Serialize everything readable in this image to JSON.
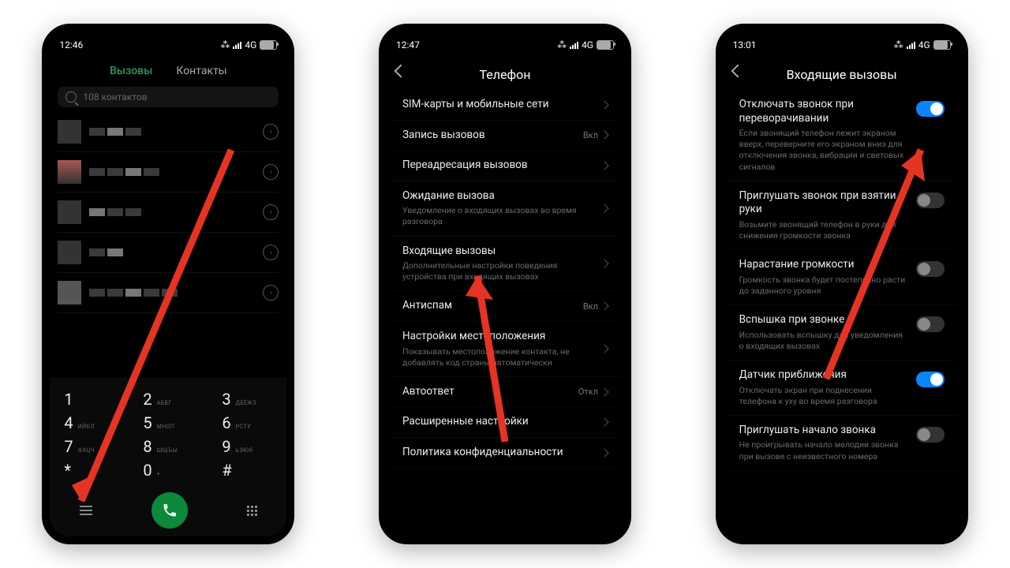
{
  "phone1": {
    "time": "12:46",
    "net": "4G",
    "tabs": {
      "calls": "Вызовы",
      "contacts": "Контакты"
    },
    "search_placeholder": "108 контактов",
    "dial": {
      "k1": "1",
      "k2": "2",
      "k2s": "АБВГ",
      "k3": "3",
      "k3s": "ДЕЁЖЗ",
      "k4": "4",
      "k4s": "ИЙКЛ",
      "k5": "5",
      "k5s": "МНОП",
      "k6": "6",
      "k6s": "РСТУ",
      "k7": "7",
      "k7s": "ФХЦЧ",
      "k8": "8",
      "k8s": "ШЩЪЫ",
      "k9": "9",
      "k9s": "ЬЭЮЯ",
      "kstar": "*",
      "k0": "0",
      "k0s": "+",
      "khash": "#"
    }
  },
  "phone2": {
    "time": "12:47",
    "net": "4G",
    "title": "Телефон",
    "rows": [
      {
        "t": "SIM-карты и мобильные сети"
      },
      {
        "t": "Запись вызовов",
        "v": "Вкл"
      },
      {
        "t": "Переадресация вызовов"
      },
      {
        "t": "Ожидание вызова",
        "s": "Уведомление о входящих вызовах во время разговора"
      },
      {
        "t": "Входящие вызовы",
        "s": "Дополнительные настройки поведения устройства при входящих вызовах"
      },
      {
        "t": "Антиспам",
        "v": "Вкл"
      },
      {
        "t": "Настройки местоположения",
        "s": "Показывать местоположение контакта, не добавлять код страны автоматически"
      },
      {
        "t": "Автоответ",
        "v": "Откл"
      },
      {
        "t": "Расширенные настройки"
      },
      {
        "t": "Политика конфиденциальности"
      }
    ]
  },
  "phone3": {
    "time": "13:01",
    "net": "4G",
    "title": "Входящие вызовы",
    "rows": [
      {
        "t": "Отключать звонок при переворачивании",
        "s": "Если звонящий телефон лежит экраном вверх, переверните его экраном вниз для отключения звонка, вибрации и световых сигналов",
        "on": true
      },
      {
        "t": "Приглушать звонок при взятии в руки",
        "s": "Возьмите звонящий телефон в руки для снижения громкости звонка",
        "on": false
      },
      {
        "t": "Нарастание громкости",
        "s": "Громкость звонка будет постепенно расти до заданного уровня",
        "on": false
      },
      {
        "t": "Вспышка при звонке",
        "s": "Использовать вспышку для уведомления о входящих вызовах",
        "on": false
      },
      {
        "t": "Датчик приближения",
        "s": "Отключать экран при поднесении телефона к уху во время разговора",
        "on": true
      },
      {
        "t": "Приглушать начало звонка",
        "s": "Не проигрывать начало мелодии звонка при вызове с неизвестного номера",
        "on": false
      }
    ]
  }
}
